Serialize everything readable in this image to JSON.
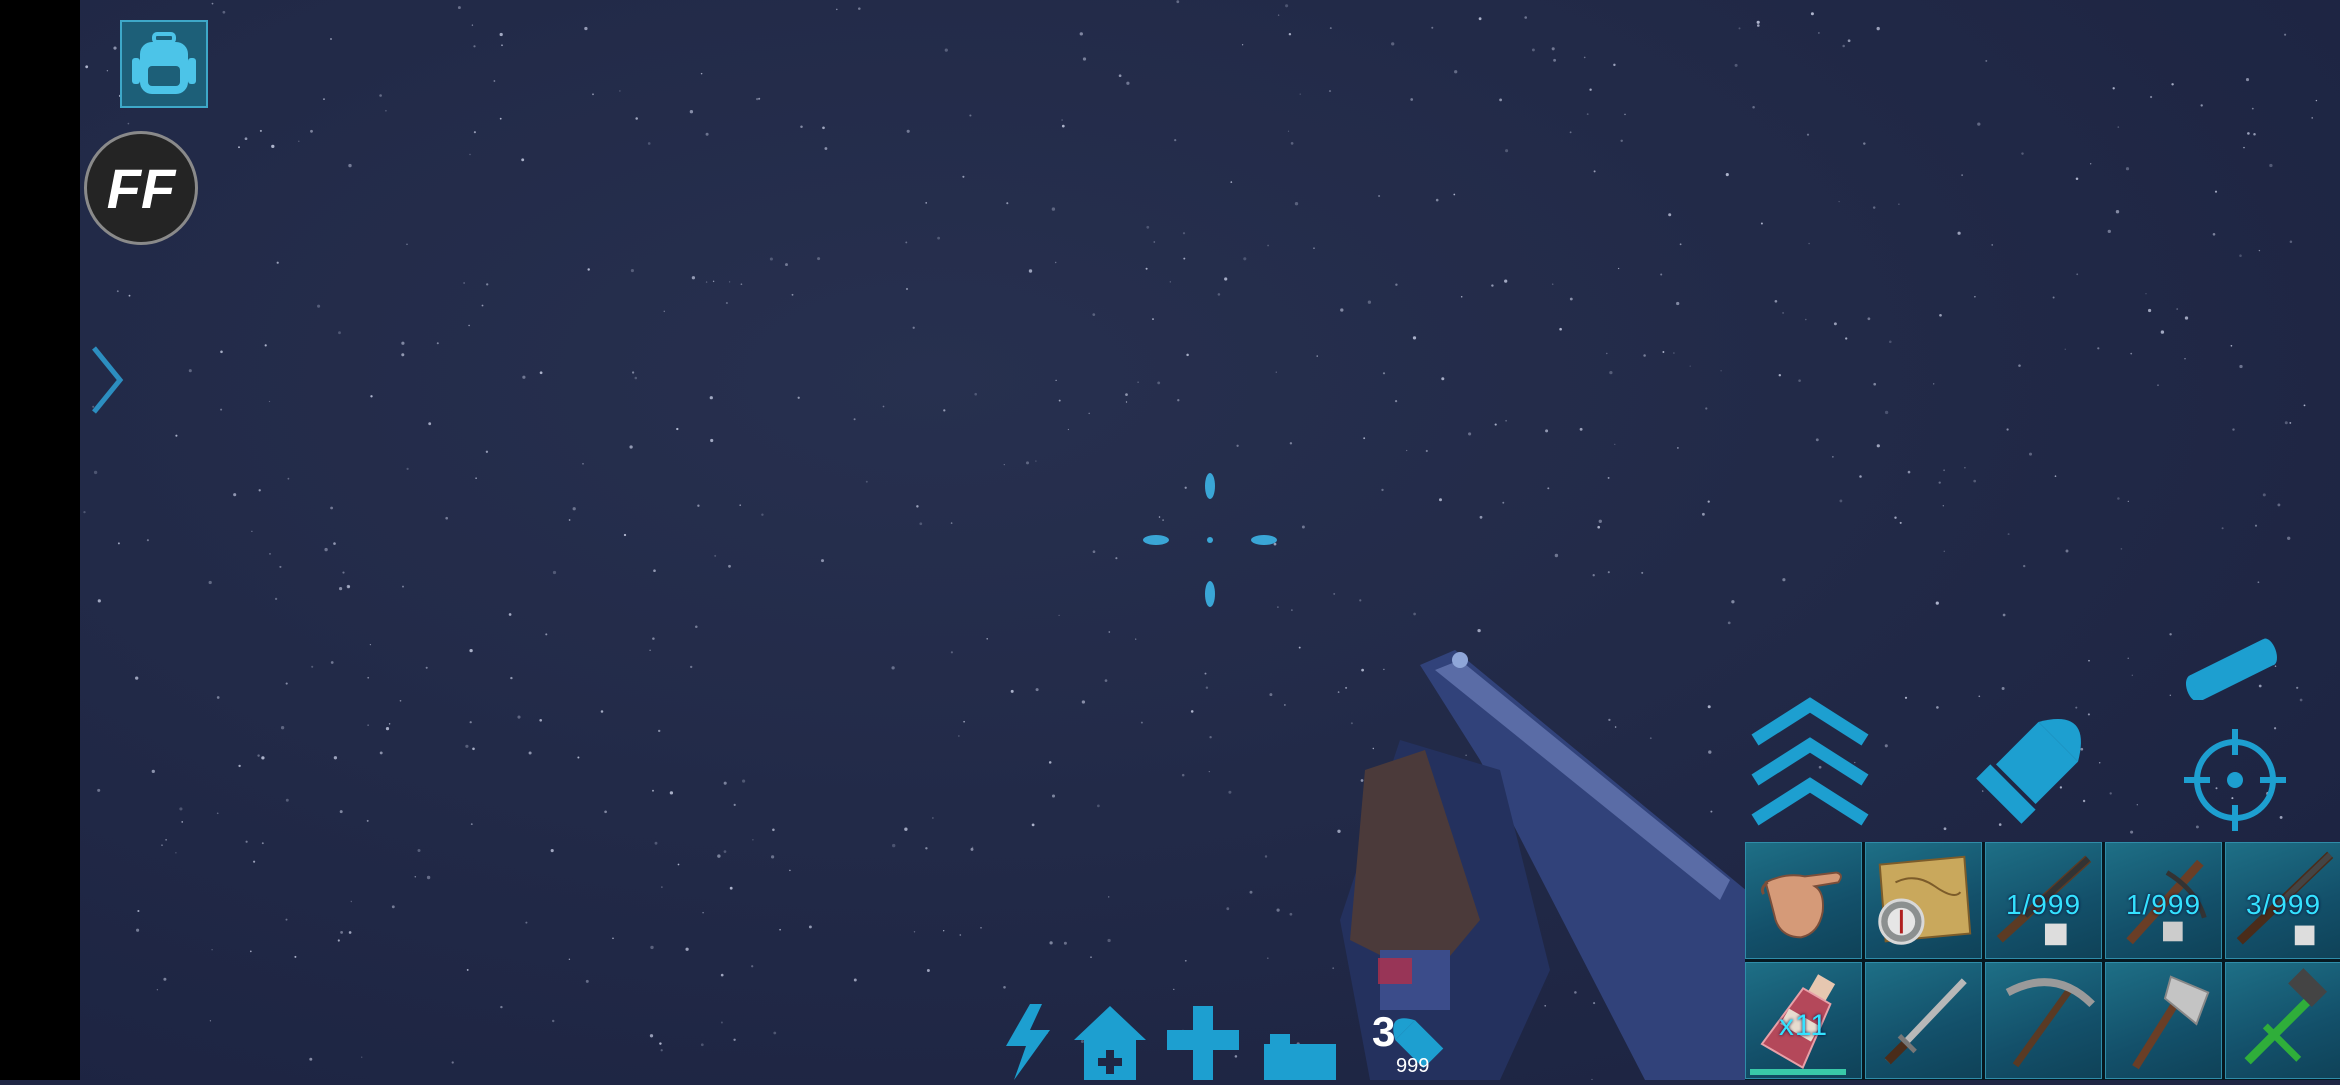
{
  "hud": {
    "ff_label": "FF",
    "ammo_loaded": "3",
    "ammo_total": "999",
    "accent_color": "#1d9fd0",
    "icons": {
      "inventory": "backpack-icon",
      "side_panel": "chevron-right-icon",
      "jump": "triple-chevron-up-icon",
      "ammo": "bullet-icon",
      "spyglass": "spyglass-icon",
      "aim": "crosshair-target-icon",
      "status": [
        "lightning-icon",
        "house-plus-icon",
        "health-plus-icon",
        "bed-icon",
        "ammo-icon"
      ]
    }
  },
  "hotbar": {
    "slots": [
      {
        "item": "hand-icon",
        "qty": ""
      },
      {
        "item": "map-compass-icon",
        "qty": ""
      },
      {
        "item": "shotgun-icon",
        "qty": "1/999"
      },
      {
        "item": "crossbow-icon",
        "qty": "1/999"
      },
      {
        "item": "rifle-icon",
        "qty": "3/999"
      },
      {
        "item": "potion-bottle-icon",
        "qty": "x11"
      },
      {
        "item": "sword-icon",
        "qty": ""
      },
      {
        "item": "pickaxe-icon",
        "qty": ""
      },
      {
        "item": "hatchet-icon",
        "qty": ""
      },
      {
        "item": "hammer-icon",
        "qty": ""
      }
    ]
  }
}
